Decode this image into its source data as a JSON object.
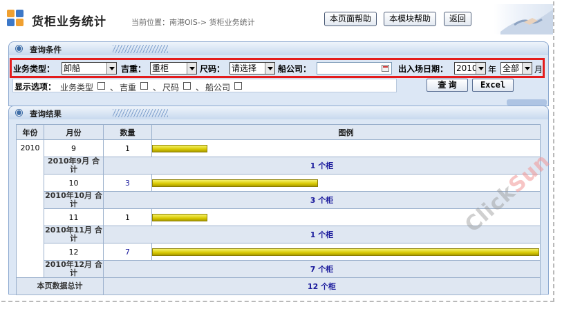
{
  "header": {
    "app_title": "货柜业务统计",
    "breadcrumb": "当前位置：南港OIS-> 货柜业务统计",
    "buttons": {
      "page_help": "本页面帮助",
      "module_help": "本模块帮助",
      "back": "返回"
    }
  },
  "query": {
    "section_title": "查询条件",
    "business_type": {
      "label": "业务类型：",
      "value": "卸船"
    },
    "full_empty": {
      "label": "吉重：",
      "value": "重柜"
    },
    "size": {
      "label": "尺码：",
      "value": "请选择"
    },
    "shipping_company": {
      "label": "船公司：",
      "value": ""
    },
    "date": {
      "label": "出入场日期：",
      "year_value": "2010",
      "year_unit": "年",
      "month_value": "全部",
      "month_unit": "月"
    },
    "display_options": {
      "label": "显示选项：",
      "options": [
        {
          "prefix": "",
          "label": "业务类型",
          "checked": false
        },
        {
          "prefix": "、",
          "label": "吉重",
          "checked": false
        },
        {
          "prefix": "、",
          "label": "尺码",
          "checked": false
        },
        {
          "prefix": "、",
          "label": "船公司",
          "checked": false
        }
      ]
    },
    "buttons": {
      "query": "查 询",
      "excel": "Excel"
    }
  },
  "result": {
    "section_title": "查询结果",
    "columns": [
      "年份",
      "月份",
      "数量",
      "图例"
    ],
    "year": "2010",
    "max_count": 7,
    "rows": [
      {
        "month": "9",
        "count": "1",
        "count_value": 1,
        "subtotal_label": "2010年9月 合计",
        "subtotal": "1 个柜"
      },
      {
        "month": "10",
        "count": "3",
        "count_value": 3,
        "subtotal_label": "2010年10月 合计",
        "subtotal": "3 个柜"
      },
      {
        "month": "11",
        "count": "1",
        "count_value": 1,
        "subtotal_label": "2010年11月 合计",
        "subtotal": "1 个柜"
      },
      {
        "month": "12",
        "count": "7",
        "count_value": 7,
        "subtotal_label": "2010年12月 合计",
        "subtotal": "7 个柜"
      }
    ],
    "grand_total_label": "本页数据总计",
    "grand_total": "12 个柜"
  },
  "watermark": {
    "text_a": "Click",
    "text_b": "Sun"
  },
  "colors": {
    "highlight_border": "#e41c1c",
    "panel": "#dce7f5",
    "bar": "#d8c800",
    "total_text": "#1a1a9c"
  }
}
